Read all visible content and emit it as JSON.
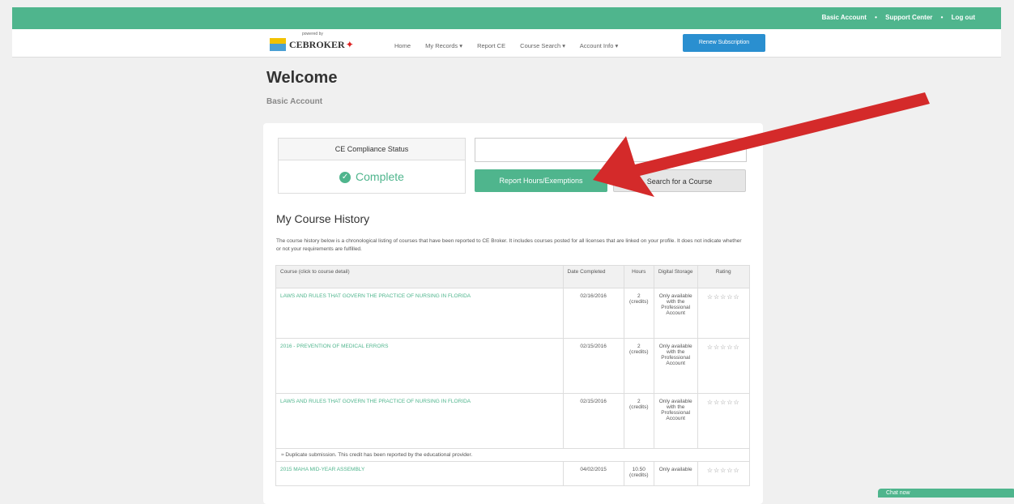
{
  "topbar": {
    "links": [
      "Basic Account",
      "Support Center",
      "Log out"
    ],
    "separator": "•"
  },
  "logo": {
    "brand": "CEBROKER",
    "tagline": "powered by"
  },
  "nav": {
    "items": [
      "Home",
      "My Records ▾",
      "Report CE",
      "Course Search ▾",
      "Account Info ▾"
    ],
    "renew_label": "Renew Subscription"
  },
  "page": {
    "title": "Welcome",
    "subtitle": "Basic Account"
  },
  "compliance": {
    "header": "CE Compliance Status",
    "value": "Complete"
  },
  "actions": {
    "report_label": "Report Hours/Exemptions",
    "search_label": "Search for a Course"
  },
  "history": {
    "title": "My Course History",
    "description": "The course history below is a chronological listing of courses that have been reported to CE Broker. It includes courses posted for all licenses that are linked on your profile. It does not indicate whether or not your requirements are fulfilled.",
    "columns": [
      "Course (click to course detail)",
      "Date Completed",
      "Hours",
      "Digital Storage",
      "Rating"
    ],
    "rows": [
      {
        "course": "LAWS AND RULES THAT GOVERN THE PRACTICE OF NURSING IN FLORIDA",
        "date": "02/16/2016",
        "hours": "2",
        "unit": "(credits)",
        "storage": "Only available with the Professional Account",
        "rating": "☆☆☆☆☆"
      },
      {
        "course": "2016 - PREVENTION OF MEDICAL ERRORS",
        "date": "02/15/2016",
        "hours": "2",
        "unit": "(credits)",
        "storage": "Only available with the Professional Account",
        "rating": "☆☆☆☆☆"
      },
      {
        "course": "LAWS AND RULES THAT GOVERN THE PRACTICE OF NURSING IN FLORIDA",
        "date": "02/15/2016",
        "hours": "2",
        "unit": "(credits)",
        "storage": "Only available with the Professional Account",
        "rating": "☆☆☆☆☆"
      },
      {
        "course": "2015 MAHA MID-YEAR ASSEMBLY",
        "date": "04/02/2015",
        "hours": "10.50",
        "unit": "(credits)",
        "storage": "Only available",
        "rating": "☆☆☆☆☆"
      }
    ],
    "duplicate_note": "≈ Duplicate submission. This credit has been reported by the educational provider."
  },
  "chat": {
    "label": "Chat now"
  },
  "colors": {
    "accent": "#4fb58d",
    "renew": "#2a8fd0",
    "arrow": "#d42a2a"
  }
}
